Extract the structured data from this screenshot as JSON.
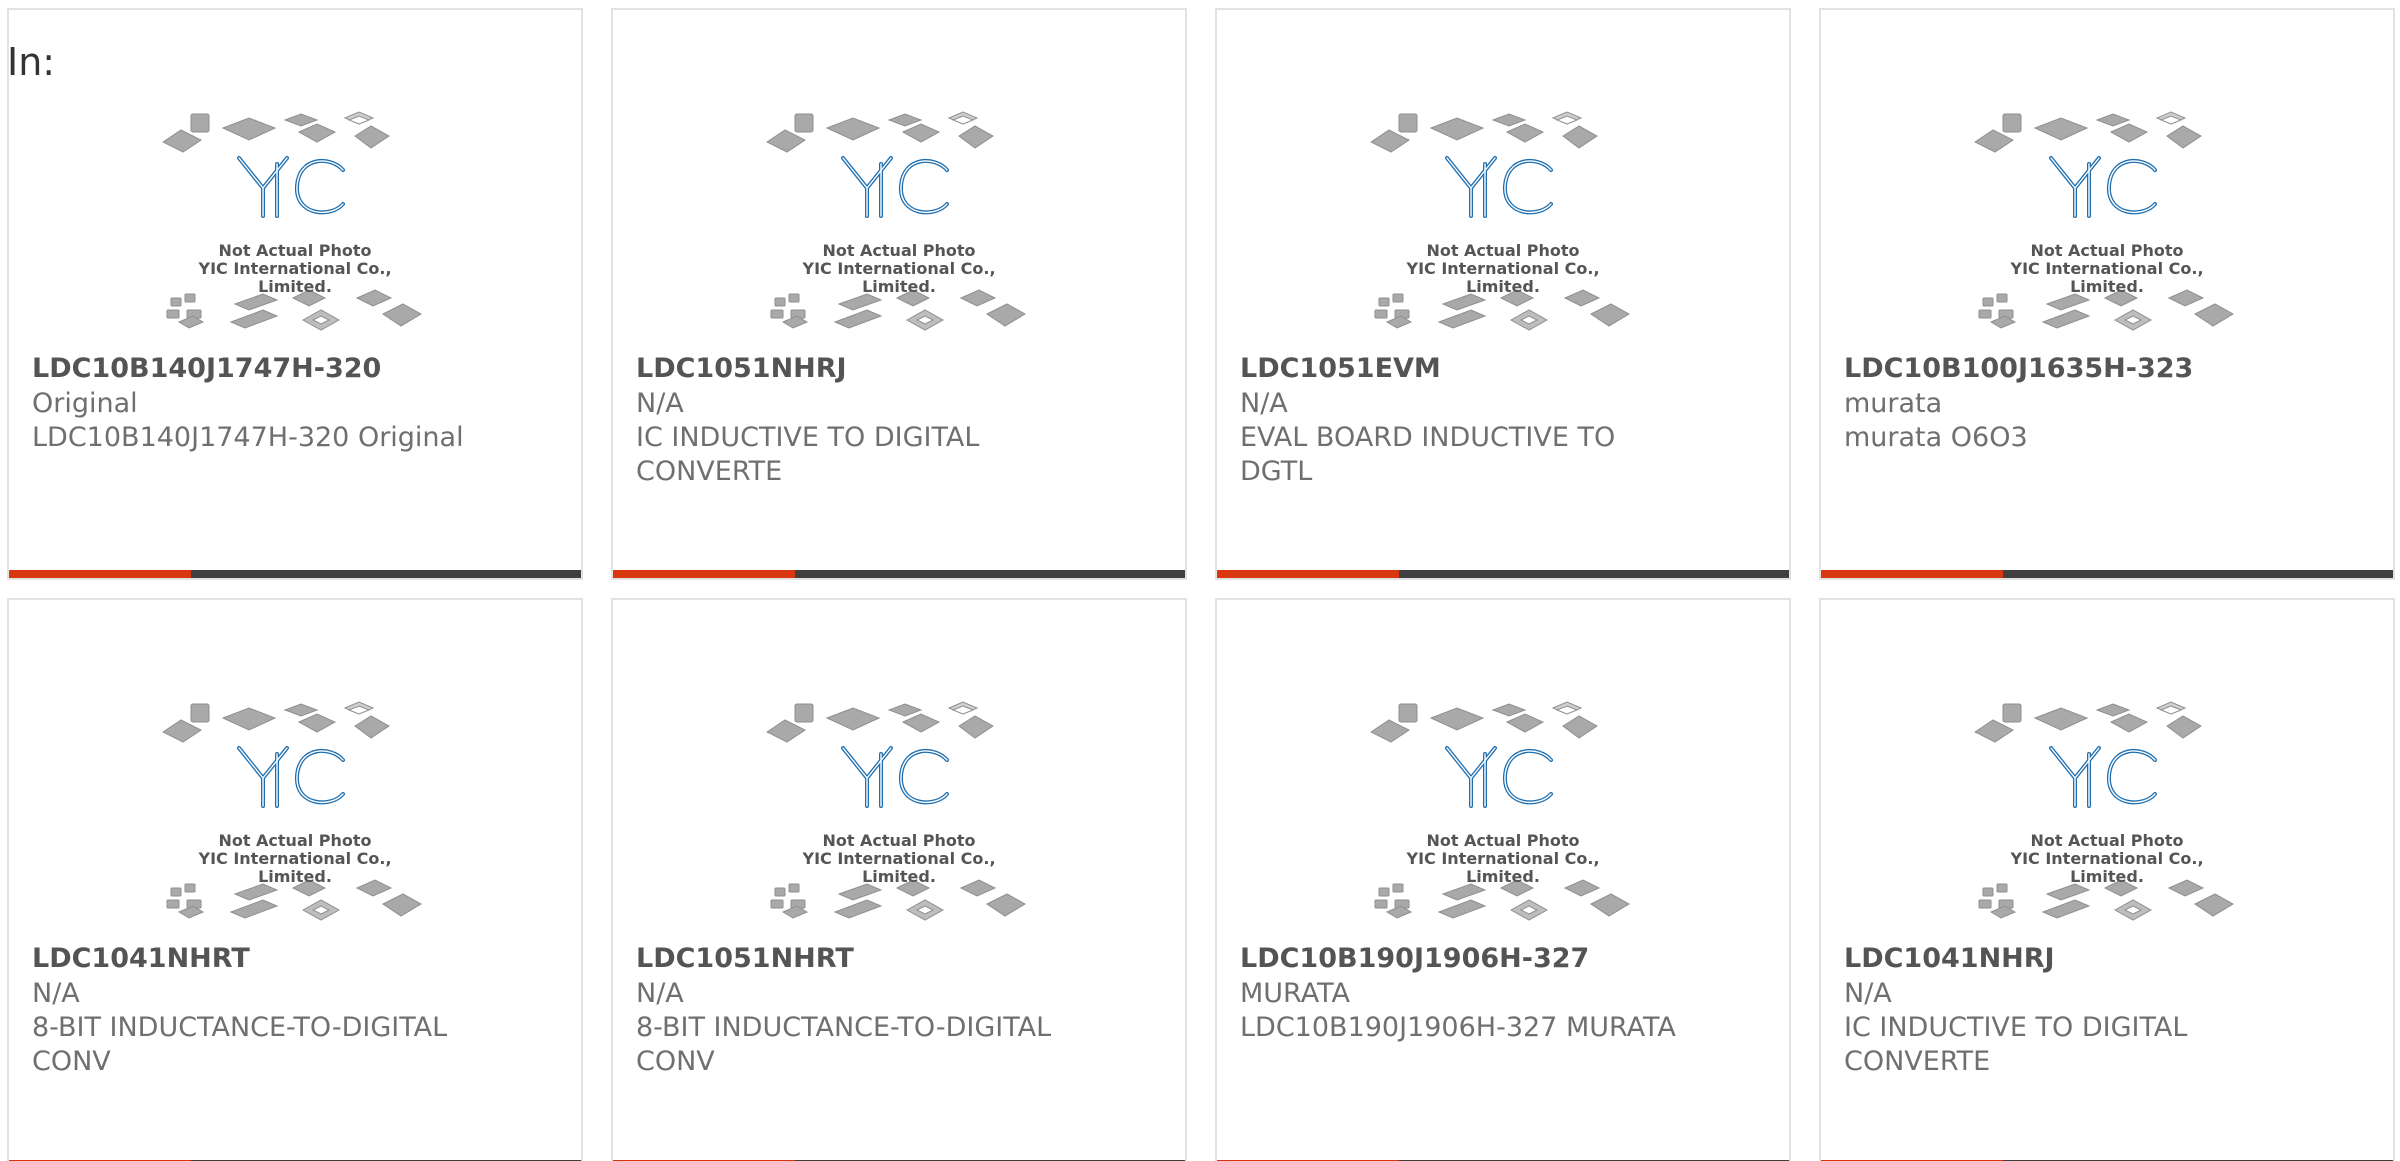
{
  "header": {
    "label": "In:"
  },
  "photo_caption": {
    "line1": "Not Actual Photo",
    "line2": "YIC International Co., Limited."
  },
  "colors": {
    "accent": "#d7360e",
    "bar": "#3f3f3f",
    "logo_blue": "#1f6fb0"
  },
  "products": [
    {
      "part": "LDC10B140J1747H-320",
      "brand": "Original",
      "desc": "LDC10B140J1747H-320 Original"
    },
    {
      "part": "LDC1051NHRJ",
      "brand": "N/A",
      "desc": "IC INDUCTIVE TO DIGITAL CONVERTE"
    },
    {
      "part": "LDC1051EVM",
      "brand": "N/A",
      "desc": "EVAL BOARD INDUCTIVE TO DGTL"
    },
    {
      "part": "LDC10B100J1635H-323",
      "brand": "murata",
      "desc": "murata O6O3"
    },
    {
      "part": "LDC1041NHRT",
      "brand": "N/A",
      "desc": "8-BIT INDUCTANCE-TO-DIGITAL CONV"
    },
    {
      "part": "LDC1051NHRT",
      "brand": "N/A",
      "desc": "8-BIT INDUCTANCE-TO-DIGITAL CONV"
    },
    {
      "part": "LDC10B190J1906H-327",
      "brand": "MURATA",
      "desc": "LDC10B190J1906H-327 MURATA"
    },
    {
      "part": "LDC1041NHRJ",
      "brand": "N/A",
      "desc": "IC INDUCTIVE TO DIGITAL CONVERTE"
    }
  ]
}
